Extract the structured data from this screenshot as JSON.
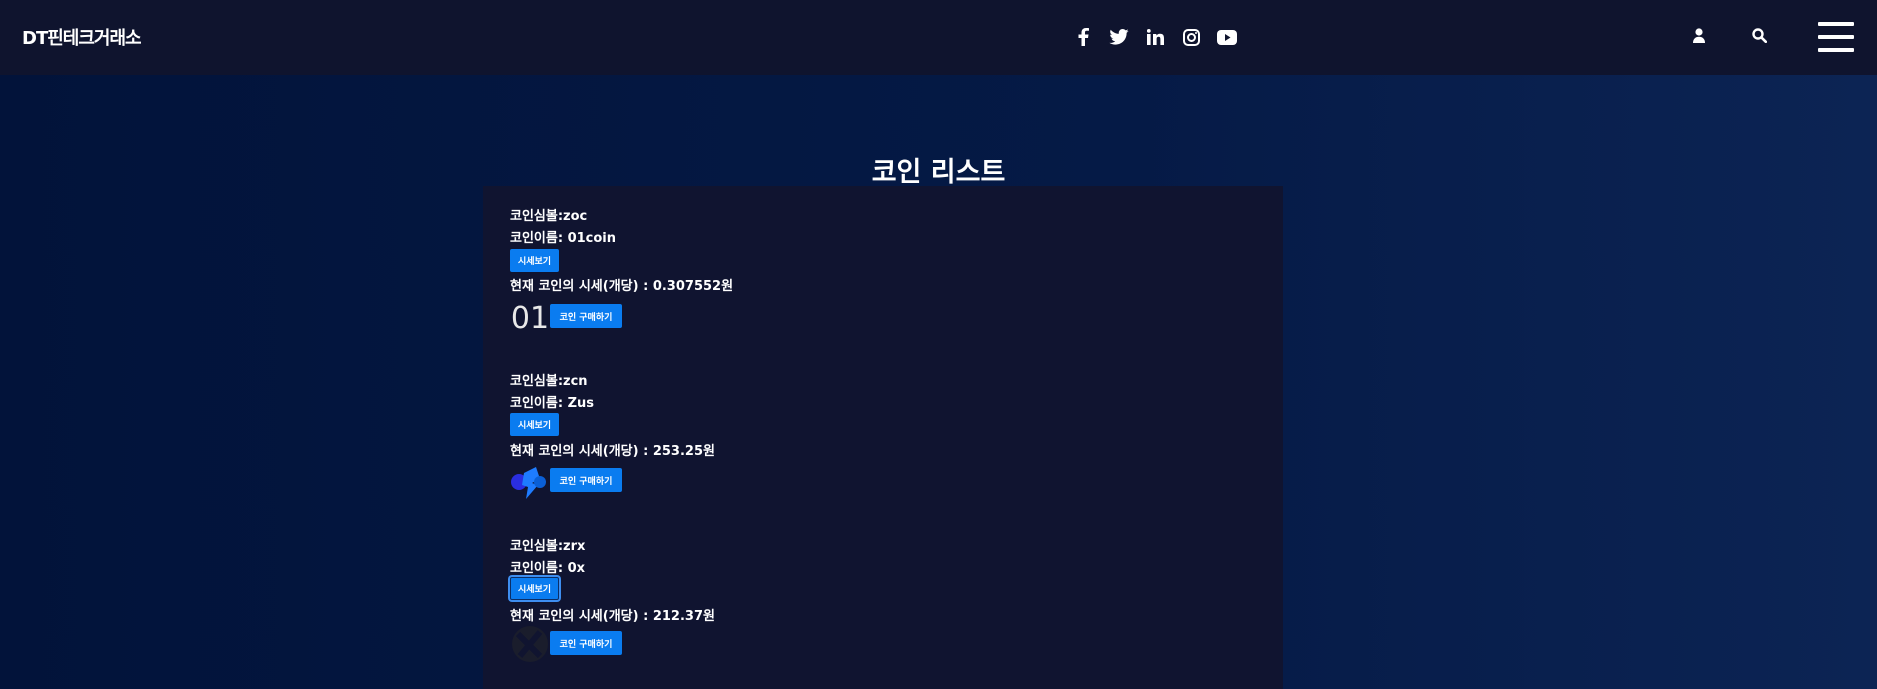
{
  "nav": {
    "brand": "DT핀테크거래소"
  },
  "page": {
    "title": "코인 리스트"
  },
  "coins": [
    {
      "symbol_line": "코인심볼:zoc",
      "name_line": "코인이름: 01coin",
      "view_button": "시세보기",
      "price_line": "현재 코인의 시세(개당) : 0.307552원",
      "logo_text": "01",
      "buy_button": "코인 구매하기"
    },
    {
      "symbol_line": "코인심볼:zcn",
      "name_line": "코인이름: Zus",
      "view_button": "시세보기",
      "price_line": "현재 코인의 시세(개당) : 253.25원",
      "buy_button": "코인 구매하기"
    },
    {
      "symbol_line": "코인심볼:zrx",
      "name_line": "코인이름: 0x",
      "view_button": "시세보기",
      "price_line": "현재 코인의 시세(개당) : 212.37원",
      "buy_button": "코인 구매하기"
    }
  ],
  "colors": {
    "nav_bg": "#0f142e",
    "page_bg": "#02133a",
    "panel_bg": "#101430",
    "button_blue": "#0a7cf0"
  },
  "icons": [
    "facebook-icon",
    "twitter-icon",
    "linkedin-icon",
    "instagram-icon",
    "youtube-icon",
    "user-icon",
    "search-icon",
    "menu-icon"
  ]
}
